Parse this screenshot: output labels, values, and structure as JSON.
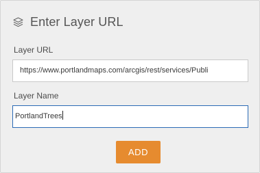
{
  "dialog": {
    "title": "Enter Layer URL",
    "title_icon": "layers-icon"
  },
  "fields": {
    "url": {
      "label": "Layer URL",
      "value": "https://www.portlandmaps.com/arcgis/rest/services/Publi"
    },
    "name": {
      "label": "Layer Name",
      "value": "PortlandTrees"
    }
  },
  "actions": {
    "add_label": "ADD",
    "add_color": "#e68b2f"
  },
  "colors": {
    "panel_background": "#efefef",
    "active_field_border": "#2a6ab5"
  }
}
